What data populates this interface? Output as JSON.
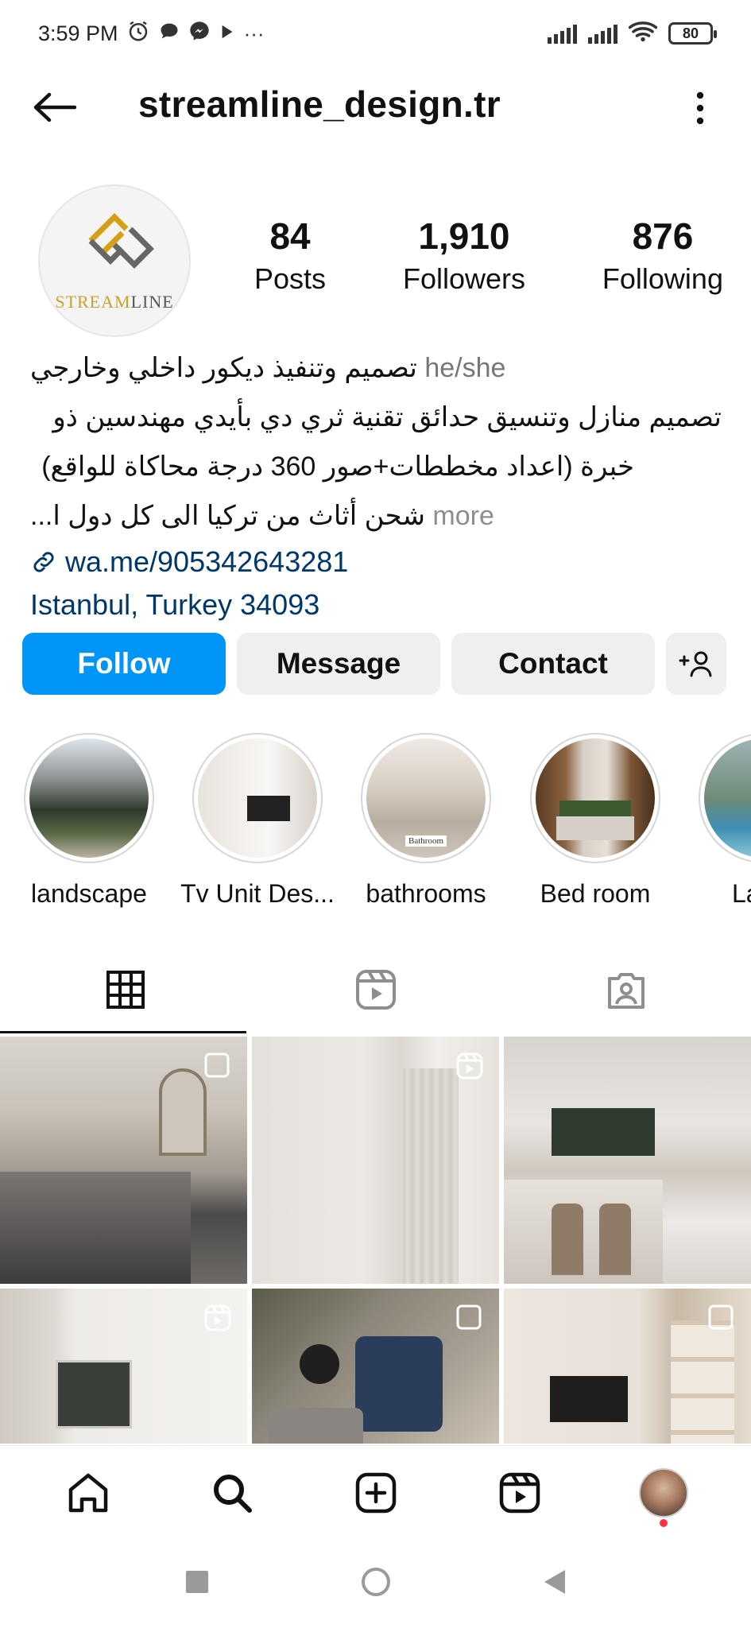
{
  "status_bar": {
    "time": "3:59 PM",
    "battery": "80",
    "more": "···"
  },
  "header": {
    "username": "streamline_design.tr"
  },
  "profile": {
    "logo_text_gold": "STREAM",
    "logo_text_dark": "LINE",
    "stats": [
      {
        "value": "84",
        "label": "Posts"
      },
      {
        "value": "1,910",
        "label": "Followers"
      },
      {
        "value": "876",
        "label": "Following"
      }
    ],
    "bio": {
      "pronouns": "he/she",
      "line1": "تصميم وتنفيذ ديكور داخلي وخارجي",
      "line2": "تصميم منازل وتنسيق حدائق تقنية ثري دي بأيدي مهندسين ذو",
      "line3": "خبرة (اعداد مخططات+صور 360 درجة محاكاة للواقع)",
      "line4": "شحن أثاث من تركيا الى كل دول ا...",
      "more": "more",
      "link": "wa.me/905342643281",
      "location": "Istanbul, Turkey 34093"
    }
  },
  "actions": {
    "follow": "Follow",
    "message": "Message",
    "contact": "Contact",
    "add_user": "+’"
  },
  "highlights": [
    {
      "label": "landscape"
    },
    {
      "label": "Tv Unit Des..."
    },
    {
      "label": "bathrooms"
    },
    {
      "label": "Bed room"
    },
    {
      "label": "Land"
    }
  ],
  "highlight_sub": {
    "bathroom_caption": "Bathroom"
  },
  "tabs": [
    "grid",
    "reels",
    "tagged"
  ],
  "posts": [
    {
      "kind": "multi",
      "scene": "bedroom"
    },
    {
      "kind": "reel",
      "scene": "hallway"
    },
    {
      "kind": "none",
      "scene": "kitchen"
    },
    {
      "kind": "reel",
      "scene": "tv-wall"
    },
    {
      "kind": "multi",
      "scene": "living"
    },
    {
      "kind": "multi",
      "scene": "tv-unit"
    }
  ],
  "colors": {
    "follow_blue": "#0095f6",
    "link_blue": "#00376b",
    "button_gray": "#efefef",
    "notif_red": "#ff3040"
  }
}
